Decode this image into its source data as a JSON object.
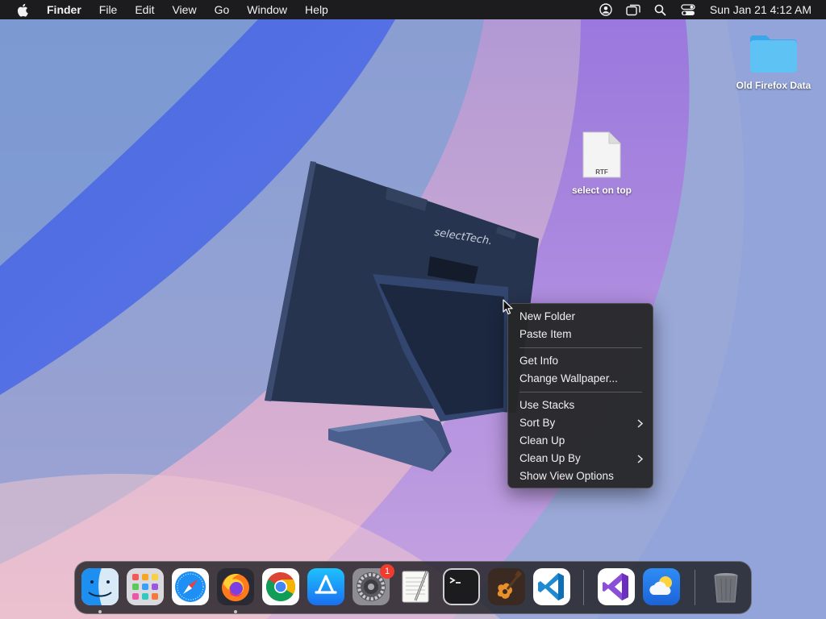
{
  "menubar": {
    "app_name": "Finder",
    "items": [
      "File",
      "Edit",
      "View",
      "Go",
      "Window",
      "Help"
    ],
    "status_icons": [
      "user-account-icon",
      "screen-mirroring-icon",
      "spotlight-search-icon",
      "control-center-icon"
    ],
    "clock": "Sun Jan 21  4:12 AM"
  },
  "desktop": {
    "icons": [
      {
        "label": "Old Firefox Data",
        "icon": "folder-icon"
      },
      {
        "label": "select on top",
        "icon": "rtf-document-icon",
        "file_type": "RTF"
      }
    ],
    "wallpaper_text": "selectTech."
  },
  "context_menu": {
    "groups": [
      [
        "New Folder",
        "Paste Item"
      ],
      [
        "Get Info",
        "Change Wallpaper..."
      ],
      [
        "Use Stacks",
        "Sort By",
        "Clean Up",
        "Clean Up By",
        "Show View Options"
      ]
    ],
    "submenu_items": [
      "Sort By",
      "Clean Up By"
    ]
  },
  "dock": {
    "apps": [
      {
        "name": "Finder",
        "running": true
      },
      {
        "name": "Launchpad",
        "running": false
      },
      {
        "name": "Safari",
        "running": false
      },
      {
        "name": "Firefox",
        "running": true
      },
      {
        "name": "Google Chrome",
        "running": false
      },
      {
        "name": "App Store",
        "running": false
      },
      {
        "name": "System Settings",
        "running": false,
        "badge": "1"
      },
      {
        "name": "TextEdit",
        "running": false
      },
      {
        "name": "Terminal",
        "running": false
      },
      {
        "name": "GarageBand",
        "running": false
      },
      {
        "name": "Visual Studio Code",
        "running": false
      },
      {
        "name": "Visual Studio",
        "running": false
      },
      {
        "name": "Weather",
        "running": false
      },
      {
        "name": "Trash",
        "running": false
      }
    ],
    "colors": {
      "accent_badge": "#f13b2f"
    }
  }
}
